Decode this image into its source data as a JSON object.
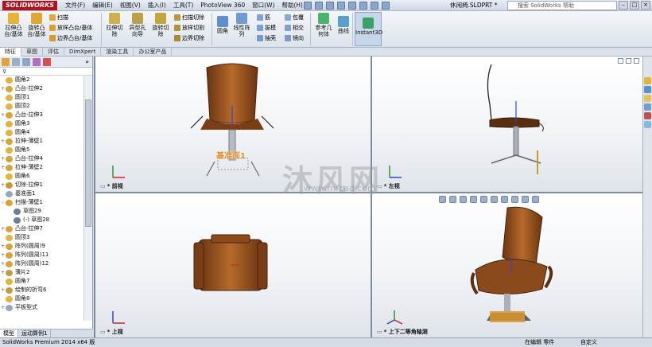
{
  "app": {
    "logo": "SOLIDWORKS",
    "doc_title": "休闲椅.SLDPRT *"
  },
  "menu": [
    "文件(F)",
    "编辑(E)",
    "视图(V)",
    "插入(I)",
    "工具(T)",
    "PhotoView 360",
    "窗口(W)",
    "帮助(H)"
  ],
  "help_search": {
    "placeholder": "搜索 SolidWorks 帮助"
  },
  "ribbon": {
    "extrude_boss": "拉伸凸\n台/基体",
    "revolve_boss": "旋转凸\n台/基体",
    "sweep": "扫描",
    "loft_boss": "放样凸台/基体",
    "boundary_boss": "边界凸台/基体",
    "extrude_cut": "拉伸切\n除",
    "hole_wizard": "异型孔\n向导",
    "revolve_cut": "旋转切\n除",
    "sweep_cut": "扫描切除",
    "loft_cut": "放样切割",
    "boundary_cut": "边界切除",
    "fillet": "圆角",
    "linear_pattern": "线性阵\n列",
    "rib": "筋",
    "draft": "拔模",
    "shell": "抽壳",
    "wrap": "包覆",
    "intersect": "相交",
    "mirror": "镜向",
    "ref_geometry": "参考几\n何体",
    "curves": "曲线",
    "instant3d": "Instant3D"
  },
  "command_tabs": [
    "特征",
    "草图",
    "评估",
    "DimXpert",
    "渲染工具",
    "办公室产品"
  ],
  "feature_tree": [
    {
      "label": "圆角2",
      "expand": "",
      "icon": "fillet-icon"
    },
    {
      "label": "凸台-拉伸2",
      "expand": "+",
      "icon": "extrude-icon"
    },
    {
      "label": "圆顶1",
      "expand": "",
      "icon": "dome-icon"
    },
    {
      "label": "圆顶2",
      "expand": "",
      "icon": "dome-icon"
    },
    {
      "label": "凸台-拉伸3",
      "expand": "+",
      "icon": "extrude-icon"
    },
    {
      "label": "圆角3",
      "expand": "",
      "icon": "fillet-icon"
    },
    {
      "label": "圆角4",
      "expand": "",
      "icon": "fillet-icon"
    },
    {
      "label": "拉伸-薄壁1",
      "expand": "+",
      "icon": "extrude-icon"
    },
    {
      "label": "圆角5",
      "expand": "",
      "icon": "fillet-icon"
    },
    {
      "label": "凸台-拉伸4",
      "expand": "+",
      "icon": "extrude-icon"
    },
    {
      "label": "拉伸-薄壁2",
      "expand": "+",
      "icon": "extrude-icon"
    },
    {
      "label": "圆角6",
      "expand": "",
      "icon": "fillet-icon"
    },
    {
      "label": "切除-拉伸1",
      "expand": "+",
      "icon": "cut-icon"
    },
    {
      "label": "基准面1",
      "expand": "",
      "icon": "plane-icon"
    },
    {
      "label": "扫描-薄壁1",
      "expand": "-",
      "icon": "sweep-icon"
    },
    {
      "label": "草图29",
      "expand": "",
      "icon": "sketch-icon",
      "indent": true
    },
    {
      "label": "(-) 草图28",
      "expand": "",
      "icon": "sketch-icon",
      "indent": true
    },
    {
      "label": "凸台-拉伸7",
      "expand": "+",
      "icon": "extrude-icon"
    },
    {
      "label": "圆顶3",
      "expand": "",
      "icon": "dome-icon"
    },
    {
      "label": "阵列(圆周)9",
      "expand": "+",
      "icon": "pattern-icon"
    },
    {
      "label": "阵列(圆周)11",
      "expand": "+",
      "icon": "pattern-icon"
    },
    {
      "label": "阵列(圆周)12",
      "expand": "+",
      "icon": "pattern-icon"
    },
    {
      "label": "薄片2",
      "expand": "+",
      "icon": "sheet-icon"
    },
    {
      "label": "圆角7",
      "expand": "",
      "icon": "fillet-icon"
    },
    {
      "label": "绘制的折弯6",
      "expand": "+",
      "icon": "bend-icon"
    },
    {
      "label": "圆角8",
      "expand": "",
      "icon": "fillet-icon"
    },
    {
      "label": "平板型式",
      "expand": "+",
      "icon": "flat-icon"
    }
  ],
  "left_tabs": [
    "模型",
    "运动算例1"
  ],
  "viewports": {
    "front": "* 前视",
    "left": "* 左视",
    "top": "* 上视",
    "iso": "* 上下二等角轴测"
  },
  "plane_label": "基准面1",
  "watermark": {
    "main": "沐风网",
    "url": "www.mfcad.com"
  },
  "status": {
    "left": "SolidWorks Premium 2014 x64 版",
    "mode": "在编辑 零件",
    "units": "自定义"
  },
  "colors": {
    "wood": "#8a4a1c",
    "accent": "#d99a2b",
    "logo": "#b3121c"
  }
}
